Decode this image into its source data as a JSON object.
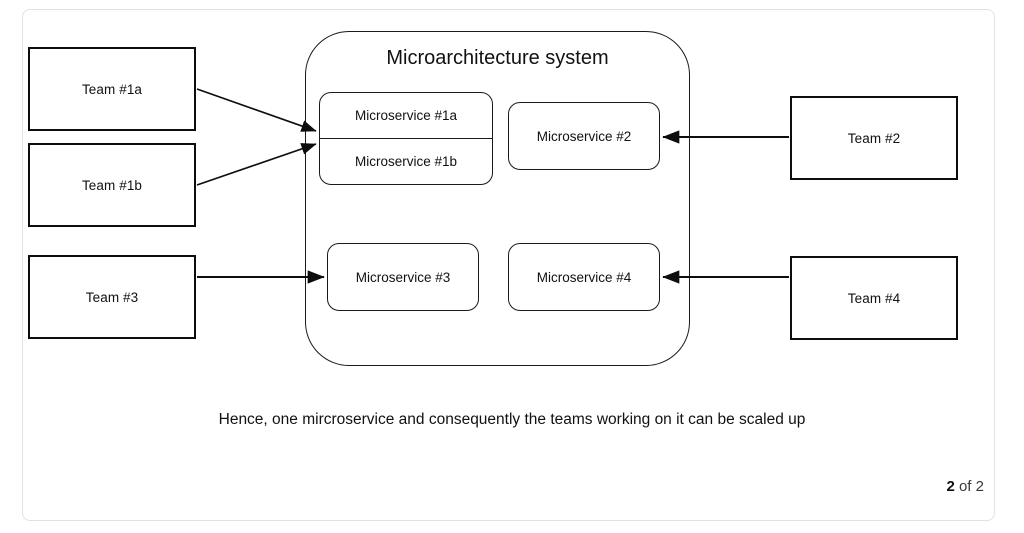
{
  "slide": {
    "page_indicator": {
      "current": "2",
      "separator": "of",
      "total": "2"
    },
    "caption": "Hence, one mircroservice and consequently the teams working on it can be scaled up"
  },
  "diagram": {
    "system": {
      "title": "Microarchitecture system",
      "microservices": [
        {
          "id": "ms-1a",
          "label": "Microservice #1a"
        },
        {
          "id": "ms-1b",
          "label": "Microservice #1b"
        },
        {
          "id": "ms-2",
          "label": "Microservice #2"
        },
        {
          "id": "ms-3",
          "label": "Microservice #3"
        },
        {
          "id": "ms-4",
          "label": "Microservice #4"
        }
      ]
    },
    "teams": [
      {
        "id": "team-1a",
        "label": "Team #1a"
      },
      {
        "id": "team-1b",
        "label": "Team #1b"
      },
      {
        "id": "team-3",
        "label": "Team #3"
      },
      {
        "id": "team-2",
        "label": "Team #2"
      },
      {
        "id": "team-4",
        "label": "Team #4"
      }
    ],
    "connections": [
      {
        "from": "Team #1a",
        "to": "Microservice #1a/#1b",
        "direction": "right"
      },
      {
        "from": "Team #1b",
        "to": "Microservice #1a/#1b",
        "direction": "right"
      },
      {
        "from": "Team #3",
        "to": "Microservice #3",
        "direction": "right"
      },
      {
        "from": "Team #2",
        "to": "Microservice #2",
        "direction": "left"
      },
      {
        "from": "Team #4",
        "to": "Microservice #4",
        "direction": "left"
      }
    ],
    "colors": {
      "stroke": "#1a1a1a",
      "team_stroke": "#0d0d0d",
      "background": "#ffffff",
      "card_border": "#e2e2e2"
    }
  }
}
